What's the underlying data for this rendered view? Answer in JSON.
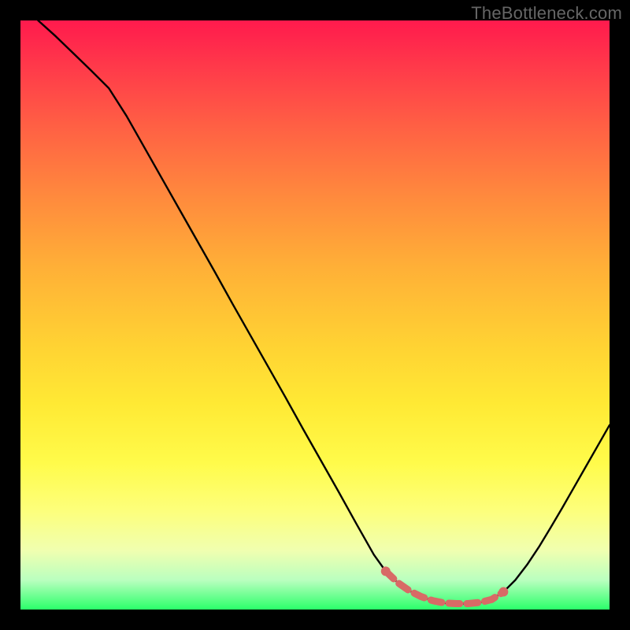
{
  "watermark": "TheBottleneck.com",
  "colors": {
    "frame": "#000000",
    "curve_stroke": "#000000",
    "marker_fill": "#d86a66",
    "gradient_top": "#ff1a4d",
    "gradient_bottom": "#2bff6a"
  },
  "chart_data": {
    "type": "line",
    "title": "",
    "xlabel": "",
    "ylabel": "",
    "xlim": [
      0,
      100
    ],
    "ylim": [
      0,
      100
    ],
    "x": [
      3,
      6,
      9,
      12,
      15,
      18,
      21,
      24,
      27,
      30,
      33,
      36,
      39,
      42,
      45,
      48,
      51,
      54,
      57,
      60,
      62,
      64,
      66,
      68,
      70,
      72,
      74,
      76,
      78,
      80,
      82,
      84,
      86,
      88,
      90,
      92,
      94,
      96,
      98,
      100
    ],
    "values": [
      100,
      97.3,
      94.4,
      91.5,
      88.5,
      83.8,
      78.5,
      73.2,
      67.9,
      62.6,
      57.3,
      51.9,
      46.6,
      41.3,
      36.0,
      30.6,
      25.3,
      20.0,
      14.6,
      9.3,
      6.5,
      4.6,
      3.2,
      2.2,
      1.5,
      1.1,
      1.0,
      1.0,
      1.2,
      1.7,
      3.0,
      5.0,
      7.6,
      10.6,
      13.9,
      17.3,
      20.8,
      24.3,
      27.8,
      31.3
    ],
    "highlight_x": [
      62,
      64,
      66,
      68,
      70,
      72,
      74,
      76,
      78,
      80,
      82
    ],
    "highlight_values": [
      6.5,
      4.6,
      3.2,
      2.2,
      1.5,
      1.1,
      1.0,
      1.0,
      1.2,
      1.7,
      3.0
    ],
    "legend": [],
    "grid": false
  }
}
